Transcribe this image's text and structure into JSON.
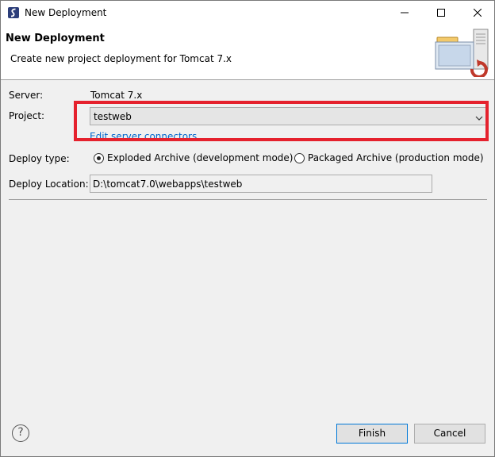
{
  "window": {
    "title": "New Deployment"
  },
  "banner": {
    "title": "New Deployment",
    "message": "Create new project deployment for Tomcat  7.x"
  },
  "form": {
    "server_label": "Server:",
    "server_value": "Tomcat  7.x",
    "project_label": "Project:",
    "project_value": "testweb",
    "edit_link": "Edit server connectors",
    "deploy_type_label": "Deploy type:",
    "deploy_options": [
      {
        "label": "Exploded Archive (development mode)",
        "selected": true
      },
      {
        "label": "Packaged Archive (production mode)",
        "selected": false
      }
    ],
    "location_label": "Deploy Location:",
    "location_value": "D:\\tomcat7.0\\webapps\\testweb"
  },
  "footer": {
    "help": "?",
    "finish_label": "Finish",
    "cancel_label": "Cancel"
  },
  "colors": {
    "highlight": "#e5212d",
    "link": "#0066cc",
    "default_button_border": "#0078d7"
  },
  "icons": {
    "app": "app-logo-icon",
    "minimize": "minimize-icon",
    "maximize": "maximize-icon",
    "close": "close-icon",
    "banner": "server-deploy-icon",
    "dropdown": "chevron-down-icon",
    "help": "help-icon"
  }
}
